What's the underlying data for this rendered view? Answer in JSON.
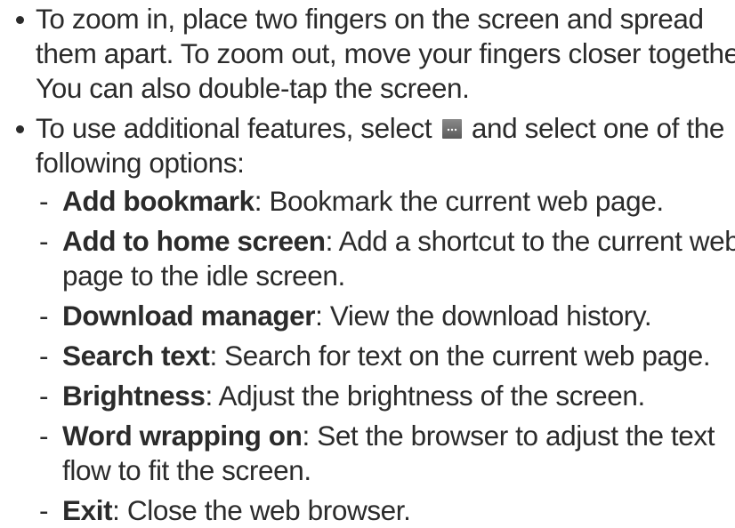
{
  "bullets": [
    {
      "lines": [
        "To zoom in, place two fingers on the screen and spread",
        "them apart. To zoom out, move your fingers closer together.",
        "You can also double-tap the screen."
      ]
    },
    {
      "line1_before_icon": "To use additional features, select",
      "line1_after_icon": "and select one of the",
      "line2": "following options:",
      "icon": "more-options-icon"
    }
  ],
  "options": [
    {
      "name": "Add bookmark",
      "desc": ": Bookmark the current web page.",
      "desc_cont": ""
    },
    {
      "name": "Add to home screen",
      "desc": ": Add a shortcut to the current web",
      "desc_cont": "page to the idle screen."
    },
    {
      "name": "Download manager",
      "desc": ": View the download history.",
      "desc_cont": ""
    },
    {
      "name": "Search text",
      "desc": ": Search for text on the current web page.",
      "desc_cont": ""
    },
    {
      "name": "Brightness",
      "desc": ": Adjust the brightness of the screen.",
      "desc_cont": ""
    },
    {
      "name": "Word wrapping on",
      "desc": ": Set the browser to adjust the text",
      "desc_cont": "flow to fit the screen."
    },
    {
      "name": "Exit",
      "desc": ": Close the web browser.",
      "desc_cont": ""
    }
  ],
  "colors": {
    "text": "#2b2b2b",
    "icon_bg": "#6f6f6f"
  }
}
